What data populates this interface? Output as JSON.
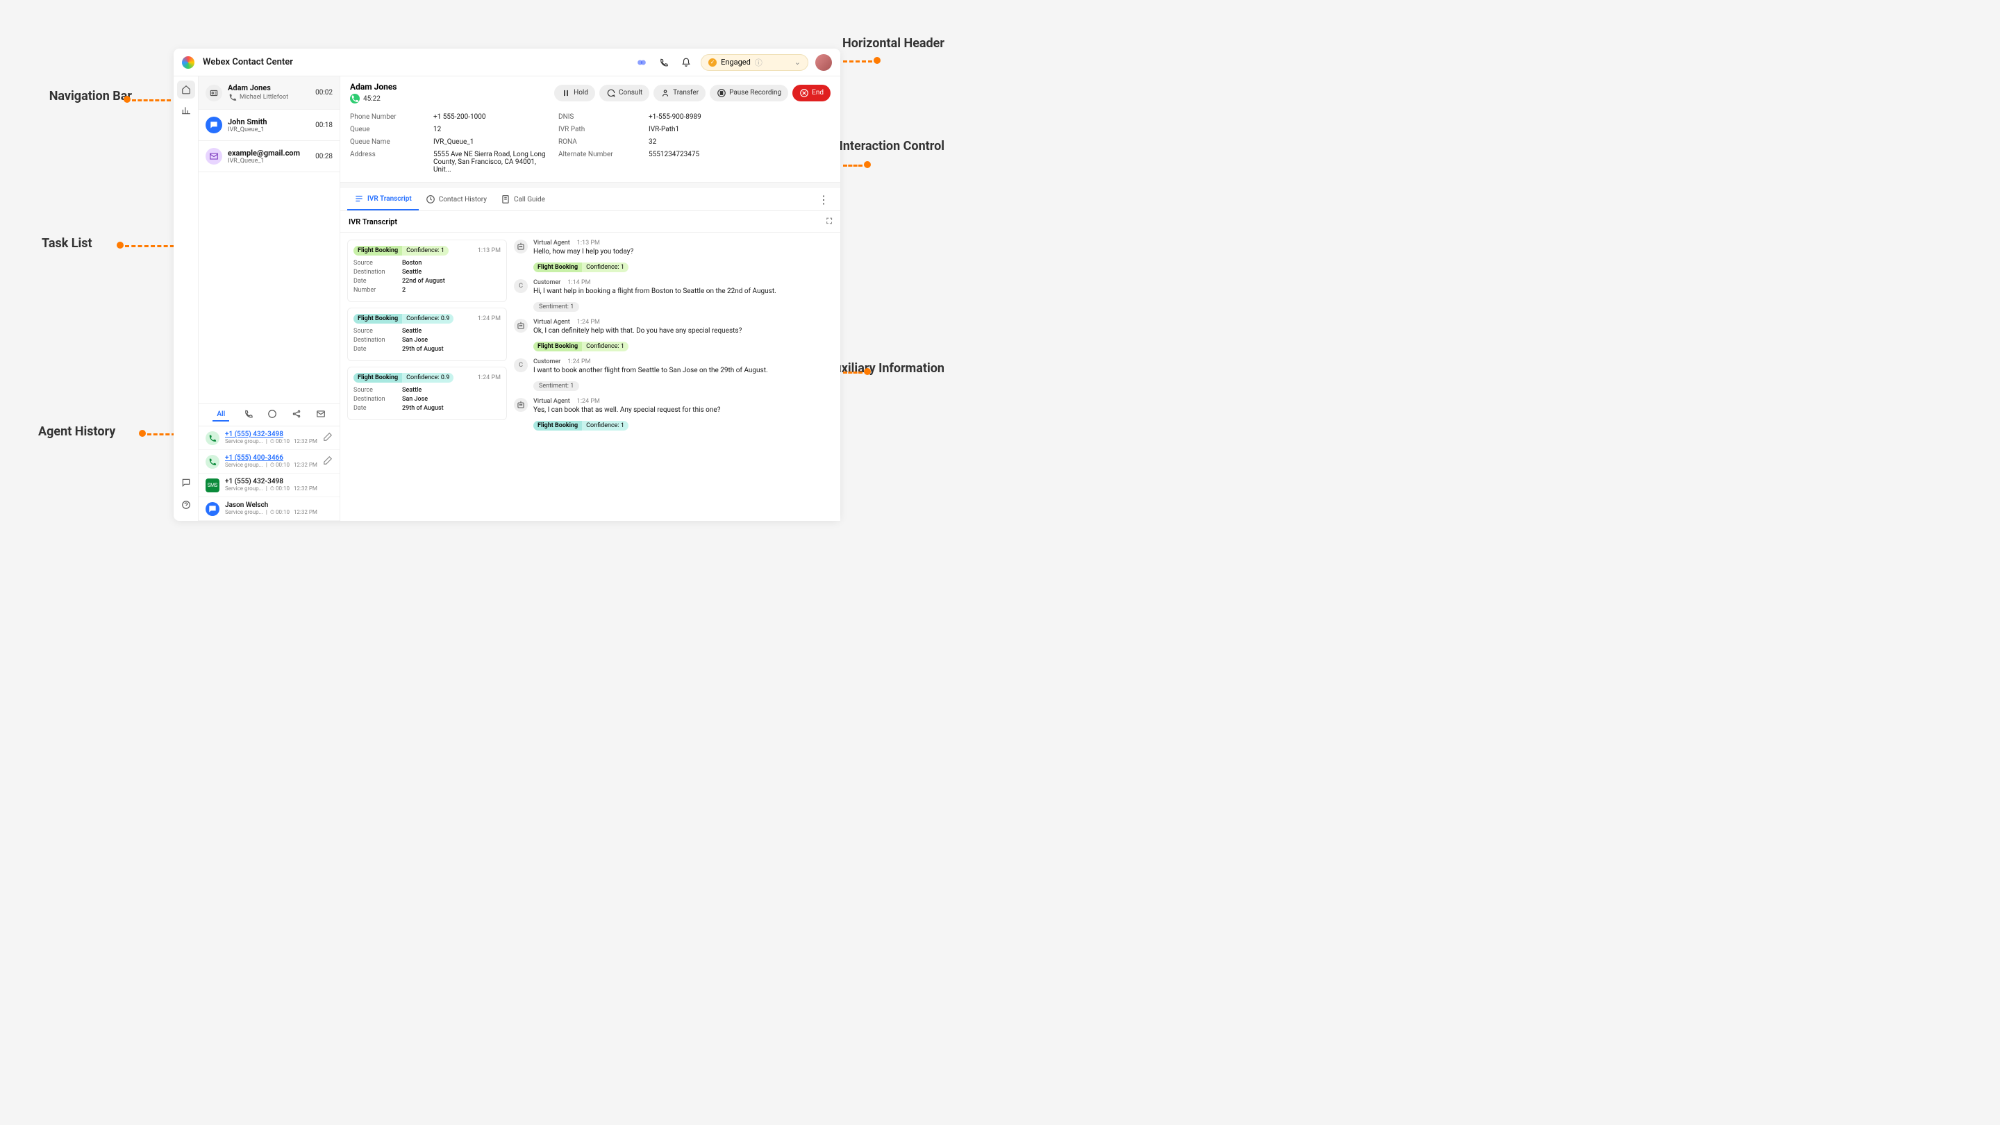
{
  "header": {
    "title": "Webex Contact Center",
    "status": "Engaged"
  },
  "tasks": [
    {
      "name": "Adam Jones",
      "sub": "Michael Littlefoot",
      "time": "00:02",
      "icon": "id"
    },
    {
      "name": "John Smith",
      "sub": "IVR_Queue_1",
      "time": "00:18",
      "icon": "chat"
    },
    {
      "name": "example@gmail.com",
      "sub": "IVR_Queue_1",
      "time": "00:28",
      "icon": "mail"
    }
  ],
  "history": {
    "tabs": [
      "All"
    ],
    "items": [
      {
        "num": "+1 (555) 432-3498",
        "link": true,
        "icon": "phone",
        "group": "Service group...",
        "dur": "00:10",
        "time": "12:32 PM",
        "edit": true
      },
      {
        "num": "+1 (555) 400-3466",
        "link": true,
        "icon": "phone",
        "group": "Service group...",
        "dur": "00:10",
        "time": "12:32 PM",
        "edit": true
      },
      {
        "num": "+1 (555) 432-3498",
        "link": false,
        "icon": "sms",
        "group": "Service group...",
        "dur": "00:10",
        "time": "12:32 PM",
        "edit": false
      },
      {
        "num": "Jason Welsch",
        "link": false,
        "icon": "chat2",
        "group": "Service group...",
        "dur": "00:10",
        "time": "12:32 PM",
        "edit": false
      }
    ]
  },
  "interaction": {
    "name": "Adam Jones",
    "timer": "45:22",
    "actions": {
      "hold": "Hold",
      "consult": "Consult",
      "transfer": "Transfer",
      "pause": "Pause Recording",
      "end": "End"
    },
    "fields": [
      {
        "l": "Phone Number",
        "v": "+1 555-200-1000"
      },
      {
        "l": "Queue",
        "v": "12"
      },
      {
        "l": "Queue Name",
        "v": "IVR_Queue_1"
      },
      {
        "l": "Address",
        "v": "5555 Ave NE Sierra Road, Long Long County, San Francisco, CA 94001, Unit..."
      },
      {
        "l": "DNIS",
        "v": "+1-555-900-8989"
      },
      {
        "l": "IVR Path",
        "v": "IVR-Path1"
      },
      {
        "l": "RONA",
        "v": "32"
      },
      {
        "l": "Alternate Number",
        "v": "5551234723475"
      }
    ]
  },
  "aux": {
    "tabs": [
      {
        "l": "IVR Transcript"
      },
      {
        "l": "Contact History"
      },
      {
        "l": "Call Guide"
      }
    ],
    "title": "IVR Transcript",
    "scripts": [
      {
        "tag": "Flight Booking",
        "conf": "Confidence: 1",
        "color": "green",
        "time": "1:13 PM",
        "rows": [
          [
            "Source",
            "Boston"
          ],
          [
            "Destination",
            "Seattle"
          ],
          [
            "Date",
            "22nd of August"
          ],
          [
            "Number",
            "2"
          ]
        ]
      },
      {
        "tag": "Flight Booking",
        "conf": "Confidence: 0.9",
        "color": "cyan",
        "time": "1:24 PM",
        "rows": [
          [
            "Source",
            "Seattle"
          ],
          [
            "Destination",
            "San Jose"
          ],
          [
            "Date",
            "29th of August"
          ]
        ]
      },
      {
        "tag": "Flight Booking",
        "conf": "Confidence: 0.9",
        "color": "cyan",
        "time": "1:24 PM",
        "rows": [
          [
            "Source",
            "Seattle"
          ],
          [
            "Destination",
            "San Jose"
          ],
          [
            "Date",
            "29th of August"
          ]
        ]
      }
    ],
    "msgs": [
      {
        "who": "Virtual Agent",
        "t": "1:13 PM",
        "txt": "Hello, how may I help you today?",
        "tag": {
          "l": "Flight Booking",
          "c": "Confidence: 1",
          "color": "green"
        },
        "av": "bot"
      },
      {
        "who": "Customer",
        "t": "1:14 PM",
        "txt": "Hi, I want help in booking a flight from Boston to Seattle on the 22nd of August.",
        "sent": "Sentiment: 1",
        "av": "C"
      },
      {
        "who": "Virtual Agent",
        "t": "1:24 PM",
        "txt": "Ok, I can definitely help with that. Do you have any special requests?",
        "tag": {
          "l": "Flight Booking",
          "c": "Confidence: 1",
          "color": "green"
        },
        "av": "bot"
      },
      {
        "who": "Customer",
        "t": "1:24 PM",
        "txt": "I want to book another flight from Seattle to San Jose on the 29th of August.",
        "sent": "Sentiment: 1",
        "av": "C"
      },
      {
        "who": "Virtual Agent",
        "t": "1:24 PM",
        "txt": "Yes, I can book that as well. Any special request for this one?",
        "tag": {
          "l": "Flight Booking",
          "c": "Confidence: 1",
          "color": "cyan"
        },
        "av": "bot"
      }
    ]
  },
  "callouts": {
    "nav": "Navigation Bar",
    "tasklist": "Task List",
    "history": "Agent History",
    "header": "Horizontal Header",
    "interaction": "Interaction Control",
    "aux": "Auxiliary Information"
  }
}
